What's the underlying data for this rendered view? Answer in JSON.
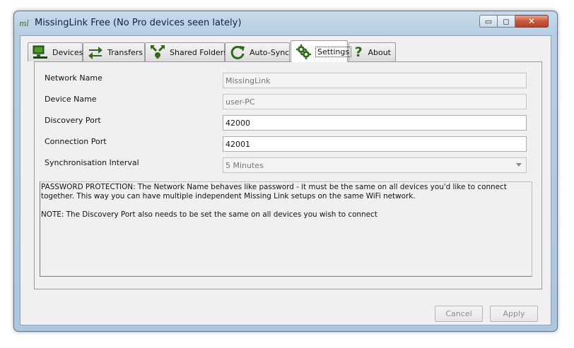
{
  "window": {
    "title": "MissingLink Free (No Pro devices seen lately)",
    "logo_text": "ml",
    "controls": {
      "minimize": "▭",
      "maximize": "◻",
      "close": "✕"
    }
  },
  "tabs": [
    {
      "label": "Devices",
      "icon": "computer-icon"
    },
    {
      "label": "Transfers",
      "icon": "transfer-arrows-icon"
    },
    {
      "label": "Shared Folders",
      "icon": "shared-folders-icon"
    },
    {
      "label": "Auto-Sync",
      "icon": "sync-icon"
    },
    {
      "label": "Settings",
      "icon": "gears-icon",
      "active": true
    },
    {
      "label": "About",
      "icon": "question-icon",
      "glyph": "?"
    }
  ],
  "settings": {
    "network_name": {
      "label": "Network Name",
      "value": "MissingLink",
      "disabled": true
    },
    "device_name": {
      "label": "Device Name",
      "value": "user-PC",
      "disabled": true
    },
    "discovery_port": {
      "label": "Discovery Port",
      "value": "42000"
    },
    "connection_port": {
      "label": "Connection Port",
      "value": "42001"
    },
    "sync_interval": {
      "label": "Synchronisation Interval",
      "value": "5 Minutes",
      "disabled": true
    }
  },
  "info": {
    "paragraph1": "PASSWORD PROTECTION: The Network Name behaves like password - it must be the same on all devices you'd like to connect together. This way you can have multiple independent Missing Link setups on the same WiFi network.",
    "paragraph2": "NOTE: The Discovery Port also needs to be set the same on all devices you wish to connect"
  },
  "buttons": {
    "cancel": "Cancel",
    "apply": "Apply"
  },
  "colors": {
    "accent_green": "#2f6a18",
    "title_bar": "#b7cde2",
    "close_red": "#c75a3e"
  }
}
